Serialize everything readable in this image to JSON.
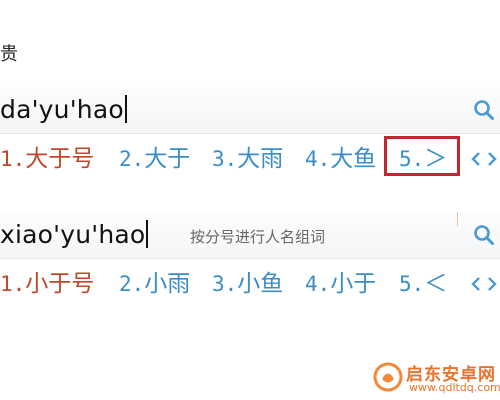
{
  "fragment": {
    "text": "贵"
  },
  "ime_one": {
    "composition": "da'yu'hao",
    "hint": "",
    "candidates": [
      {
        "num": "1.",
        "text": "大于号",
        "selected": true
      },
      {
        "num": "2.",
        "text": "大于",
        "selected": false
      },
      {
        "num": "3.",
        "text": "大雨",
        "selected": false
      },
      {
        "num": "4.",
        "text": "大鱼",
        "selected": false
      },
      {
        "num": "5.",
        "text": "＞",
        "selected": false
      }
    ],
    "highlighted_candidate": "5"
  },
  "ime_two": {
    "composition": "xiao'yu'hao",
    "hint": "按分号进行人名组词",
    "candidates": [
      {
        "num": "1.",
        "text": "小于号",
        "selected": true
      },
      {
        "num": "2.",
        "text": "小雨",
        "selected": false
      },
      {
        "num": "3.",
        "text": "小鱼",
        "selected": false
      },
      {
        "num": "4.",
        "text": "小于",
        "selected": false
      },
      {
        "num": "5.",
        "text": "＜",
        "selected": false
      }
    ]
  },
  "watermark": {
    "title": "启东安卓网",
    "url": "www.qdltdq.com"
  },
  "colors": {
    "selected_candidate": "#c0472a",
    "candidate": "#3a8dc7",
    "highlight_box": "#c0262e",
    "search_icon": "#3a8dc7",
    "watermark": "#e8742c"
  },
  "icons": [
    "search-icon",
    "page-left-icon",
    "page-right-icon",
    "watermark-logo-icon"
  ]
}
